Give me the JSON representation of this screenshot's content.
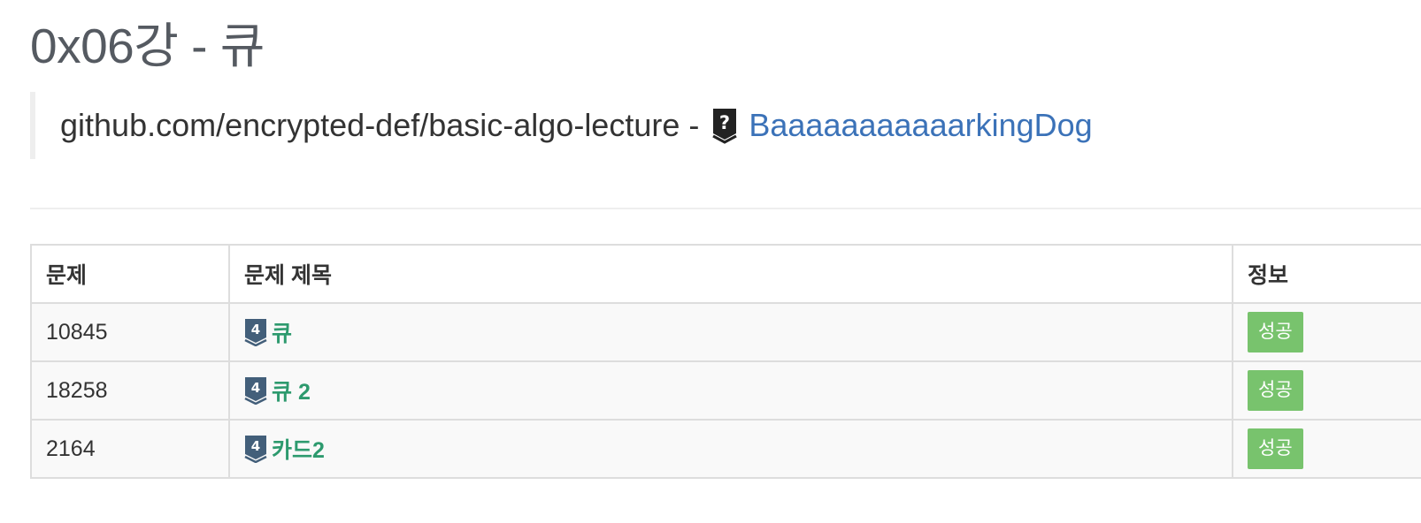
{
  "page": {
    "title": "0x06강 - 큐"
  },
  "info": {
    "repo_text": "github.com/encrypted-def/basic-algo-lecture",
    "separator": "-",
    "author_icon": "unranked-question-badge-icon",
    "author_name": "BaaaaaaaaaaarkingDog"
  },
  "table": {
    "headers": {
      "id": "문제",
      "title": "문제 제목",
      "info": "정보"
    },
    "rows": [
      {
        "id": "10845",
        "tier": "4",
        "tier_icon": "tier-badge-icon",
        "title": "큐",
        "status": "성공"
      },
      {
        "id": "18258",
        "tier": "4",
        "tier_icon": "tier-badge-icon",
        "title": "큐 2",
        "status": "성공"
      },
      {
        "id": "2164",
        "tier": "4",
        "tier_icon": "tier-badge-icon",
        "title": "카드2",
        "status": "성공"
      }
    ]
  },
  "colors": {
    "title": "#555a61",
    "link": "#3b72b8",
    "problem_link": "#2d9a6e",
    "success_badge": "#78c36d",
    "tier_badge": "#435f7a"
  }
}
